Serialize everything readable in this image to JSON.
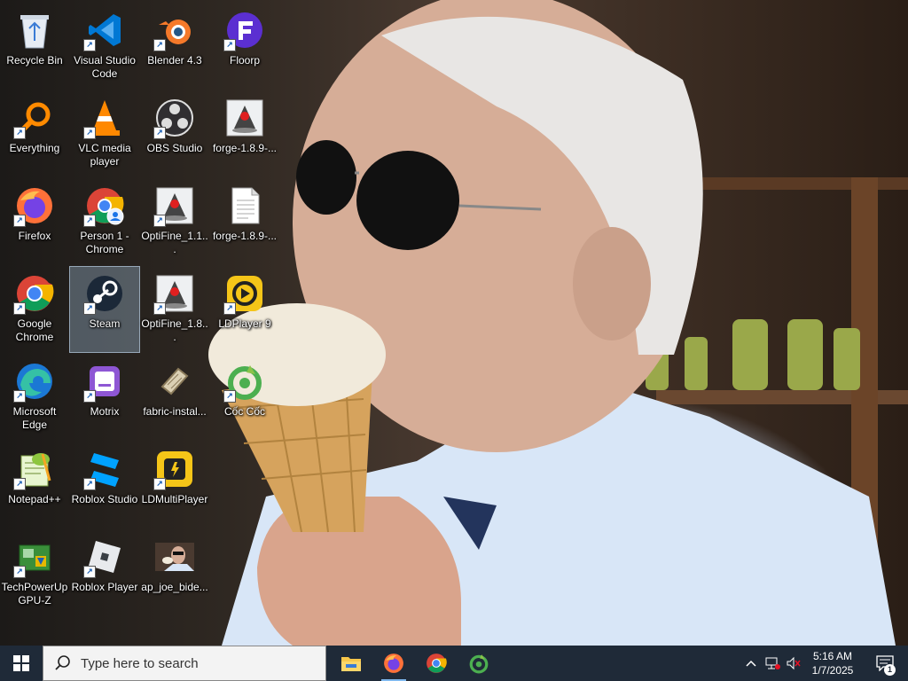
{
  "desktop": {
    "icons": [
      {
        "label": "Recycle Bin",
        "icon": "recycle-bin-icon"
      },
      {
        "label": "Visual Studio Code",
        "icon": "vscode-icon"
      },
      {
        "label": "Blender 4.3",
        "icon": "blender-icon"
      },
      {
        "label": "Floorp",
        "icon": "floorp-icon"
      },
      {
        "label": "Everything",
        "icon": "everything-search-icon"
      },
      {
        "label": "VLC media player",
        "icon": "vlc-icon"
      },
      {
        "label": "OBS Studio",
        "icon": "obs-icon"
      },
      {
        "label": "forge-1.8.9-...",
        "icon": "java-icon"
      },
      {
        "label": "Firefox",
        "icon": "firefox-icon"
      },
      {
        "label": "Person 1 - Chrome",
        "icon": "chrome-profile-icon"
      },
      {
        "label": "OptiFine_1.1...",
        "icon": "java-icon"
      },
      {
        "label": "forge-1.8.9-...",
        "icon": "text-file-icon"
      },
      {
        "label": "Google Chrome",
        "icon": "chrome-icon"
      },
      {
        "label": "Steam",
        "icon": "steam-icon"
      },
      {
        "label": "OptiFine_1.8...",
        "icon": "java-icon"
      },
      {
        "label": "LDPlayer 9",
        "icon": "ldplayer-icon"
      },
      {
        "label": "Microsoft Edge",
        "icon": "edge-icon"
      },
      {
        "label": "Motrix",
        "icon": "motrix-icon"
      },
      {
        "label": "fabric-instal...",
        "icon": "fabric-icon"
      },
      {
        "label": "Cốc Cốc",
        "icon": "coccoc-icon"
      },
      {
        "label": "Notepad++",
        "icon": "notepadpp-icon"
      },
      {
        "label": "Roblox Studio",
        "icon": "roblox-studio-icon"
      },
      {
        "label": "LDMultiPlayer",
        "icon": "ldmultiplayer-icon"
      },
      {
        "label": "TechPowerUp GPU-Z",
        "icon": "gpuz-icon"
      },
      {
        "label": "Roblox Player",
        "icon": "roblox-player-icon"
      },
      {
        "label": "ap_joe_bide...",
        "icon": "image-thumbnail-icon"
      }
    ],
    "selected_icon": "Steam"
  },
  "taskbar": {
    "search_placeholder": "Type here to search",
    "pinned": [
      {
        "name": "File Explorer",
        "icon": "file-explorer-icon"
      },
      {
        "name": "Firefox",
        "icon": "firefox-icon"
      },
      {
        "name": "Google Chrome",
        "icon": "chrome-icon"
      },
      {
        "name": "Cốc Cốc",
        "icon": "coccoc-icon"
      }
    ],
    "clock": {
      "time": "5:16 AM",
      "date": "1/7/2025"
    },
    "notification_count": "1"
  },
  "colors": {
    "taskbar_bg": "#1f2a38",
    "accent": "#7fb8ee"
  }
}
